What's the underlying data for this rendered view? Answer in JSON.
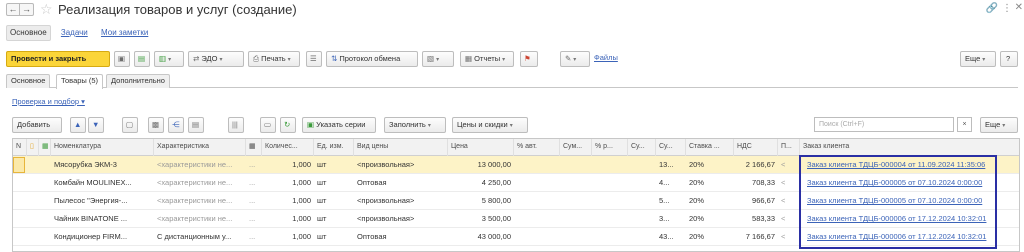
{
  "window": {
    "title": "Реализация товаров и услуг (создание)"
  },
  "sections": [
    {
      "label": "Основное",
      "active": true
    },
    {
      "label": "Задачи",
      "active": false
    },
    {
      "label": "Мои заметки",
      "active": false
    }
  ],
  "toolbar": {
    "post_close": "Провести и закрыть",
    "edo": "ЭДО",
    "print": "Печать",
    "exchange_protocol": "Протокол обмена",
    "reports": "Отчеты",
    "files": "Файлы",
    "more": "Еще",
    "help": "?"
  },
  "tabs": [
    {
      "label": "Основное"
    },
    {
      "label": "Товары (5)"
    },
    {
      "label": "Дополнительно"
    }
  ],
  "check_link": "Проверка и подбор",
  "table_toolbar": {
    "add": "Добавить",
    "specify_series": "Указать серии",
    "fill": "Заполнить",
    "prices_discounts": "Цены и скидки",
    "search_placeholder": "Поиск (Ctrl+F)",
    "clear": "×",
    "more": "Еще"
  },
  "table": {
    "columns": [
      "N",
      "",
      "",
      "Номенклатура",
      "Характеристика",
      "",
      "Количес...",
      "Ед. изм.",
      "Вид цены",
      "Цена",
      "% авт.",
      "Сум...",
      "% р...",
      "Су...",
      "Су...",
      "Ставка ...",
      "НДС",
      "П...",
      "Заказ клиента"
    ],
    "rows": [
      {
        "name": "Мясорубка ЭКМ-3",
        "char": "<характеристики не...",
        "qty": "1,000",
        "unit": "шт",
        "price_type": "<произвольная>",
        "price": "13 000,00",
        "sum": "13...",
        "rate": "20%",
        "vat": "2 166,67",
        "p": "<",
        "order": "Заказ клиента ТДЦБ-000004 от 11.09.2024 11:35:06"
      },
      {
        "name": "Комбайн MOULINEX...",
        "char": "<характеристики не...",
        "qty": "1,000",
        "unit": "шт",
        "price_type": "Оптовая",
        "price": "4 250,00",
        "sum": "4...",
        "rate": "20%",
        "vat": "708,33",
        "p": "<",
        "order": "Заказ клиента ТДЦБ-000005 от 07.10.2024 0:00:00"
      },
      {
        "name": "Пылесос \"Энергия-...",
        "char": "<характеристики не...",
        "qty": "1,000",
        "unit": "шт",
        "price_type": "<произвольная>",
        "price": "5 800,00",
        "sum": "5...",
        "rate": "20%",
        "vat": "966,67",
        "p": "<",
        "order": "Заказ клиента ТДЦБ-000005 от 07.10.2024 0:00:00"
      },
      {
        "name": "Чайник BINATONE ...",
        "char": "<характеристики не...",
        "qty": "1,000",
        "unit": "шт",
        "price_type": "<произвольная>",
        "price": "3 500,00",
        "sum": "3...",
        "rate": "20%",
        "vat": "583,33",
        "p": "<",
        "order": "Заказ клиента ТДЦБ-000006 от 17.12.2024 10:32:01"
      },
      {
        "name": "Кондиционер FIRM...",
        "char": "С дистанционным у...",
        "qty": "1,000",
        "unit": "шт",
        "price_type": "Оптовая",
        "price": "43 000,00",
        "sum": "43...",
        "rate": "20%",
        "vat": "7 166,67",
        "p": "<",
        "order": "Заказ клиента ТДЦБ-000006 от 17.12.2024 10:32:01"
      }
    ]
  }
}
